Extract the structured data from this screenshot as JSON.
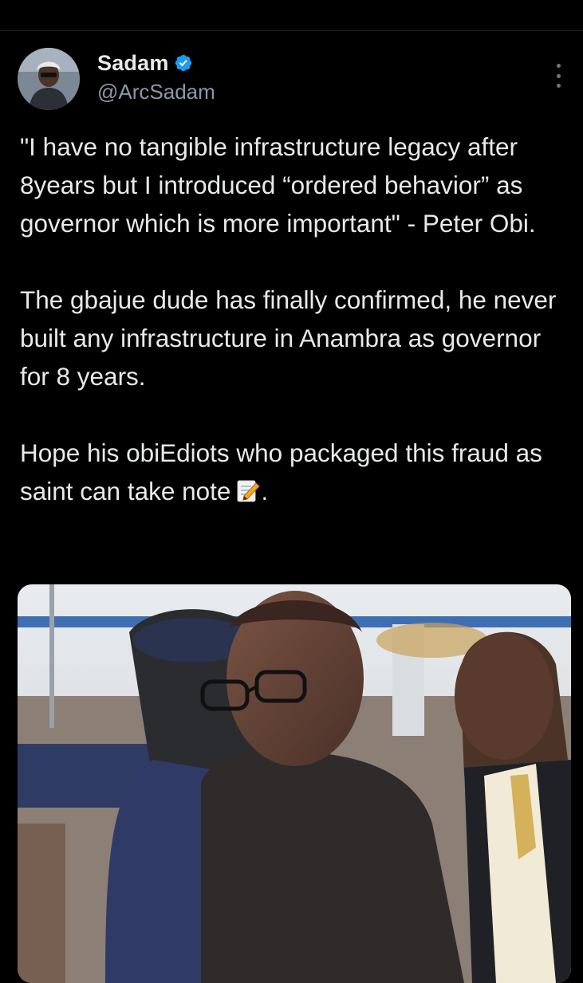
{
  "tweet": {
    "author": {
      "display_name": "Sadam",
      "handle": "@ArcSadam",
      "verified_icon": "verified-badge-icon",
      "avatar_icon": "profile-avatar"
    },
    "menu_icon": "more-vertical-icon",
    "paragraphs": [
      "\"I have no tangible infrastructure legacy after 8years but I introduced “ordered behavior” as governor which is more important\" - Peter Obi.",
      "The gbajue dude has finally confirmed, he never built any infrastructure in Anambra as governor for 8 years.",
      "Hope his obiEdiots who packaged this fraud as saint can take note"
    ],
    "paragraph_suffix_icon": "memo-icon",
    "paragraph_end": ".",
    "media": {
      "type": "photo"
    }
  },
  "colors": {
    "background": "#000000",
    "text": "#e7e9ea",
    "secondary_text": "#8b98a5",
    "verified_blue": "#1d9bf0"
  }
}
